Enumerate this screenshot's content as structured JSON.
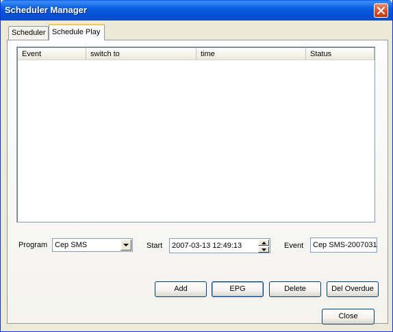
{
  "window": {
    "title": "Scheduler Manager"
  },
  "tabs": [
    {
      "label": "Scheduler"
    },
    {
      "label": "Schedule Play"
    }
  ],
  "list": {
    "columns": [
      "Event",
      "switch to",
      "time",
      "Status"
    ],
    "rows": []
  },
  "form": {
    "program_label": "Program",
    "program_value": "Cep SMS",
    "start_label": "Start",
    "start_value": "2007-03-13 12:49:13",
    "event_label": "Event",
    "event_value": "Cep SMS-2007031"
  },
  "buttons": {
    "add": "Add",
    "epg": "EPG",
    "delete": "Delete",
    "del_overdue": "Del Overdue",
    "close": "Close"
  },
  "colors": {
    "titlebar": "#0a5fe8",
    "dialog_bg": "#ece9d8",
    "close_btn": "#d8491f",
    "tab_highlight": "#ffc83c"
  }
}
